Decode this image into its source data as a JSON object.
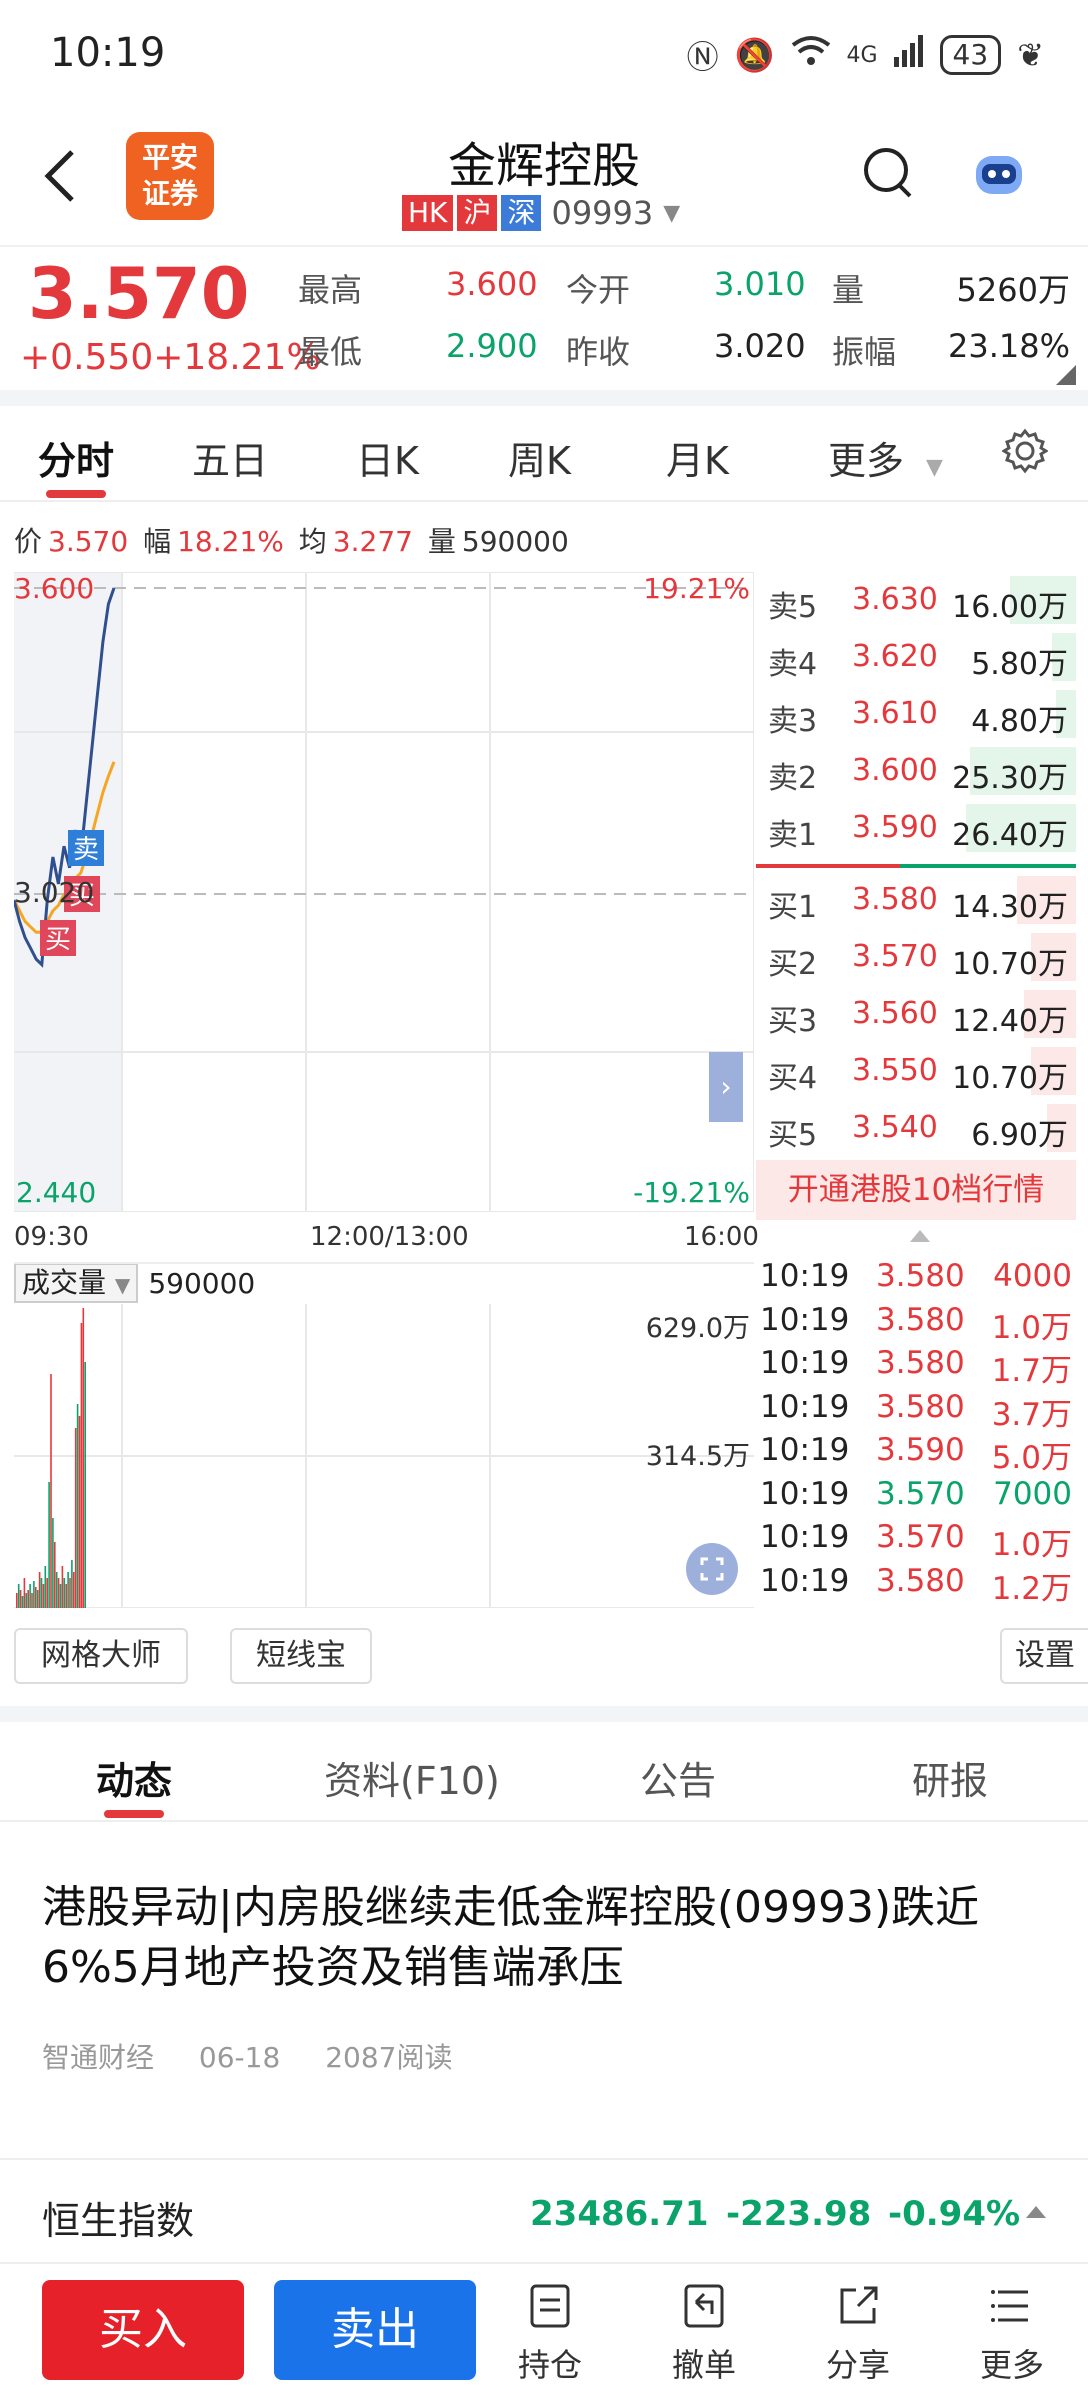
{
  "status": {
    "time": "10:19",
    "net": "4G",
    "battery": "43"
  },
  "header": {
    "logo_line1": "平安",
    "logo_line2": "证券",
    "stock_name": "金辉控股",
    "tags": [
      "HK",
      "沪",
      "深"
    ],
    "code": "09993"
  },
  "quote": {
    "price": "3.570",
    "change": "+0.550",
    "change_pct": "+18.21%",
    "high_label": "最高",
    "high": "3.600",
    "low_label": "最低",
    "low": "2.900",
    "open_label": "今开",
    "open": "3.010",
    "prev_label": "昨收",
    "prev": "3.020",
    "vol_label": "量",
    "vol": "5260万",
    "amp_label": "振幅",
    "amp": "23.18%"
  },
  "k_tabs": [
    "分时",
    "五日",
    "日K",
    "周K",
    "月K",
    "更多"
  ],
  "info": {
    "price_label": "价",
    "price": "3.570",
    "pct_label": "幅",
    "pct": "18.21%",
    "avg_label": "均",
    "avg": "3.277",
    "vol_label": "量",
    "vol": "590000"
  },
  "chart_data": {
    "type": "line",
    "y_top_label": "3.600",
    "y_mid_label": "3.020",
    "y_bottom_label": "2.440",
    "pct_top_label": "19.21%",
    "pct_bottom_label": "-19.21%",
    "x_labels": [
      "09:30",
      "12:00/13:00",
      "16:00"
    ],
    "ylim": [
      2.44,
      3.6
    ],
    "series": [
      {
        "values": [
          3.02,
          2.98,
          2.95,
          2.93,
          2.91,
          2.9,
          3.02,
          3.1,
          3.05,
          3.12,
          3.08,
          3.15,
          3.1,
          3.2,
          3.3,
          3.4,
          3.5,
          3.57,
          3.6
        ]
      },
      {
        "values": [
          3.02,
          3.0,
          2.98,
          2.97,
          2.96,
          2.96,
          2.98,
          3.0,
          3.01,
          3.03,
          3.04,
          3.06,
          3.07,
          3.1,
          3.14,
          3.18,
          3.22,
          3.25,
          3.277
        ]
      }
    ],
    "markers": [
      {
        "label": "买"
      },
      {
        "label": "卖"
      },
      {
        "label": "买"
      }
    ]
  },
  "sell_orders": [
    {
      "label": "卖5",
      "price": "3.630",
      "vol": "16.00万",
      "fill": 0.6
    },
    {
      "label": "卖4",
      "price": "3.620",
      "vol": "5.80万",
      "fill": 0.22
    },
    {
      "label": "卖3",
      "price": "3.610",
      "vol": "4.80万",
      "fill": 0.18
    },
    {
      "label": "卖2",
      "price": "3.600",
      "vol": "25.30万",
      "fill": 0.96
    },
    {
      "label": "卖1",
      "price": "3.590",
      "vol": "26.40万",
      "fill": 1.0
    }
  ],
  "buy_orders": [
    {
      "label": "买1",
      "price": "3.580",
      "vol": "14.30万",
      "fill": 0.54
    },
    {
      "label": "买2",
      "price": "3.570",
      "vol": "10.70万",
      "fill": 0.41
    },
    {
      "label": "买3",
      "price": "3.560",
      "vol": "12.40万",
      "fill": 0.47
    },
    {
      "label": "买4",
      "price": "3.550",
      "vol": "10.70万",
      "fill": 0.41
    },
    {
      "label": "买5",
      "price": "3.540",
      "vol": "6.90万",
      "fill": 0.26
    }
  ],
  "promo": "开通港股10档行情",
  "volume": {
    "label": "成交量",
    "value": "590000",
    "top_label": "629.0万",
    "mid_label": "314.5万",
    "bars": [
      {
        "v": 0.05,
        "c": "red"
      },
      {
        "v": 0.08,
        "c": "green"
      },
      {
        "v": 0.06,
        "c": "red"
      },
      {
        "v": 0.04,
        "c": "green"
      },
      {
        "v": 0.1,
        "c": "red"
      },
      {
        "v": 0.05,
        "c": "green"
      },
      {
        "v": 0.06,
        "c": "red"
      },
      {
        "v": 0.08,
        "c": "green"
      },
      {
        "v": 0.05,
        "c": "red"
      },
      {
        "v": 0.09,
        "c": "green"
      },
      {
        "v": 0.07,
        "c": "red"
      },
      {
        "v": 0.06,
        "c": "green"
      },
      {
        "v": 0.12,
        "c": "red"
      },
      {
        "v": 0.1,
        "c": "green"
      },
      {
        "v": 0.08,
        "c": "red"
      },
      {
        "v": 0.14,
        "c": "green"
      },
      {
        "v": 0.1,
        "c": "red"
      },
      {
        "v": 0.42,
        "c": "green"
      },
      {
        "v": 0.78,
        "c": "red"
      },
      {
        "v": 0.3,
        "c": "green"
      },
      {
        "v": 0.22,
        "c": "red"
      },
      {
        "v": 0.12,
        "c": "green"
      },
      {
        "v": 0.1,
        "c": "red"
      },
      {
        "v": 0.08,
        "c": "green"
      },
      {
        "v": 0.14,
        "c": "red"
      },
      {
        "v": 0.1,
        "c": "green"
      },
      {
        "v": 0.08,
        "c": "red"
      },
      {
        "v": 0.12,
        "c": "green"
      },
      {
        "v": 0.1,
        "c": "red"
      },
      {
        "v": 0.16,
        "c": "green"
      },
      {
        "v": 0.12,
        "c": "red"
      },
      {
        "v": 0.6,
        "c": "red"
      },
      {
        "v": 0.68,
        "c": "green"
      },
      {
        "v": 0.64,
        "c": "red"
      },
      {
        "v": 0.95,
        "c": "red"
      },
      {
        "v": 1.0,
        "c": "red"
      },
      {
        "v": 0.82,
        "c": "green"
      }
    ]
  },
  "ticks": [
    {
      "time": "10:19",
      "price": "3.580",
      "vol": "4000",
      "c": "red"
    },
    {
      "time": "10:19",
      "price": "3.580",
      "vol": "1.0万",
      "c": "red"
    },
    {
      "time": "10:19",
      "price": "3.580",
      "vol": "1.7万",
      "c": "red"
    },
    {
      "time": "10:19",
      "price": "3.580",
      "vol": "3.7万",
      "c": "red"
    },
    {
      "time": "10:19",
      "price": "3.590",
      "vol": "5.0万",
      "c": "red"
    },
    {
      "time": "10:19",
      "price": "3.570",
      "vol": "7000",
      "c": "green"
    },
    {
      "time": "10:19",
      "price": "3.570",
      "vol": "1.0万",
      "c": "red"
    },
    {
      "time": "10:19",
      "price": "3.580",
      "vol": "1.2万",
      "c": "red"
    }
  ],
  "tools": {
    "grid": "网格大师",
    "short": "短线宝",
    "settings": "设置"
  },
  "content_tabs": [
    "动态",
    "资料(F10)",
    "公告",
    "研报"
  ],
  "article": {
    "title": "港股异动|内房股继续走低金辉控股(09993)跌近6%5月地产投资及销售端承压",
    "source": "智通财经",
    "date": "06-18",
    "reads": "2087阅读"
  },
  "index": {
    "name": "恒生指数",
    "value": "23486.71",
    "change": "-223.98",
    "pct": "-0.94%"
  },
  "bottom": {
    "buy": "买入",
    "sell": "卖出",
    "nav": [
      "持仓",
      "撤单",
      "分享",
      "更多"
    ]
  },
  "colors": {
    "red": "#e4393c",
    "green": "#0aa36a",
    "blue": "#1a73e8"
  }
}
